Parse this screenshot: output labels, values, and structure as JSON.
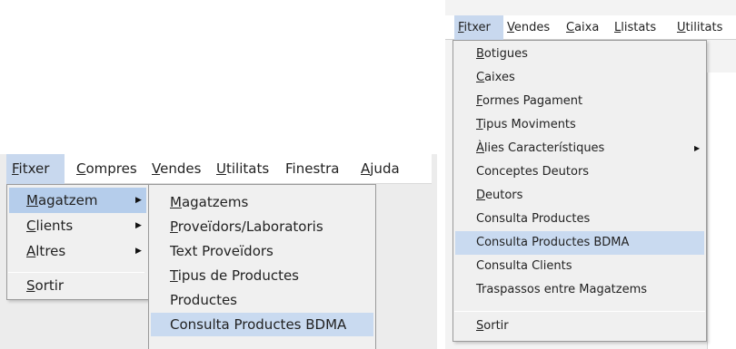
{
  "left": {
    "menubar": [
      "Fitxer",
      "Compres",
      "Vendes",
      "Utilitats",
      "Finestra",
      "Ajuda"
    ],
    "fitxer_menu": {
      "items": [
        {
          "label": "Magatzem",
          "submenu": true
        },
        {
          "label": "Clients",
          "submenu": true
        },
        {
          "label": "Altres",
          "submenu": true
        }
      ],
      "exit_label": "Sortir",
      "submenu_arrow": "▶"
    },
    "magatzem_submenu": [
      "Magatzems",
      "Proveïdors/Laboratoris",
      "Text Proveïdors",
      "Tipus de Productes",
      "Productes",
      "Consulta Productes BDMA"
    ]
  },
  "right": {
    "menubar": [
      "Fitxer",
      "Vendes",
      "Caixa",
      "Llistats",
      "Utilitats"
    ],
    "fitxer_menu": [
      "Botigues",
      "Caixes",
      "Formes Pagament",
      "Tipus Moviments",
      "Àlies Característiques",
      "Conceptes Deutors",
      "Deutors",
      "Consulta Productes",
      "Consulta Productes BDMA",
      "Consulta Clients",
      "Traspassos entre Magatzems"
    ],
    "exit_label": "Sortir",
    "submenu_arrow": "▶"
  },
  "colors": {
    "highlight": "#c9daf0",
    "menu_bg": "#f0f0f0",
    "border": "#9a9a9a"
  }
}
